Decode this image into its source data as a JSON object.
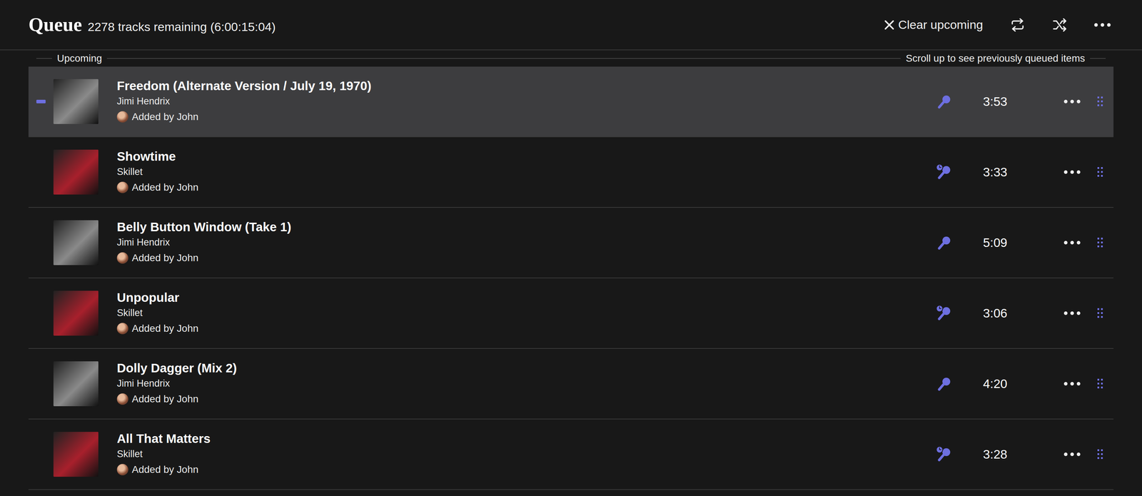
{
  "header": {
    "title": "Queue",
    "summary": "2278 tracks remaining (6:00:15:04)",
    "clear_label": "Clear upcoming"
  },
  "divider": {
    "left": "Upcoming",
    "right": "Scroll up to see previously queued items"
  },
  "tracks": [
    {
      "title": "Freedom (Alternate Version / July 19, 1970)",
      "artist": "Jimi Hendrix",
      "added_by": "Added by John",
      "duration": "3:53",
      "kind": "plain",
      "selected": true,
      "color": "#8a8a8a"
    },
    {
      "title": "Showtime",
      "artist": "Skillet",
      "added_by": "Added by John",
      "duration": "3:33",
      "kind": "synced",
      "selected": false,
      "color": "#a8202c"
    },
    {
      "title": "Belly Button Window (Take 1)",
      "artist": "Jimi Hendrix",
      "added_by": "Added by John",
      "duration": "5:09",
      "kind": "plain",
      "selected": false,
      "color": "#8a8a8a"
    },
    {
      "title": "Unpopular",
      "artist": "Skillet",
      "added_by": "Added by John",
      "duration": "3:06",
      "kind": "synced",
      "selected": false,
      "color": "#a8202c"
    },
    {
      "title": "Dolly Dagger (Mix 2)",
      "artist": "Jimi Hendrix",
      "added_by": "Added by John",
      "duration": "4:20",
      "kind": "plain",
      "selected": false,
      "color": "#8a8a8a"
    },
    {
      "title": "All That Matters",
      "artist": "Skillet",
      "added_by": "Added by John",
      "duration": "3:28",
      "kind": "synced",
      "selected": false,
      "color": "#a8202c"
    }
  ]
}
